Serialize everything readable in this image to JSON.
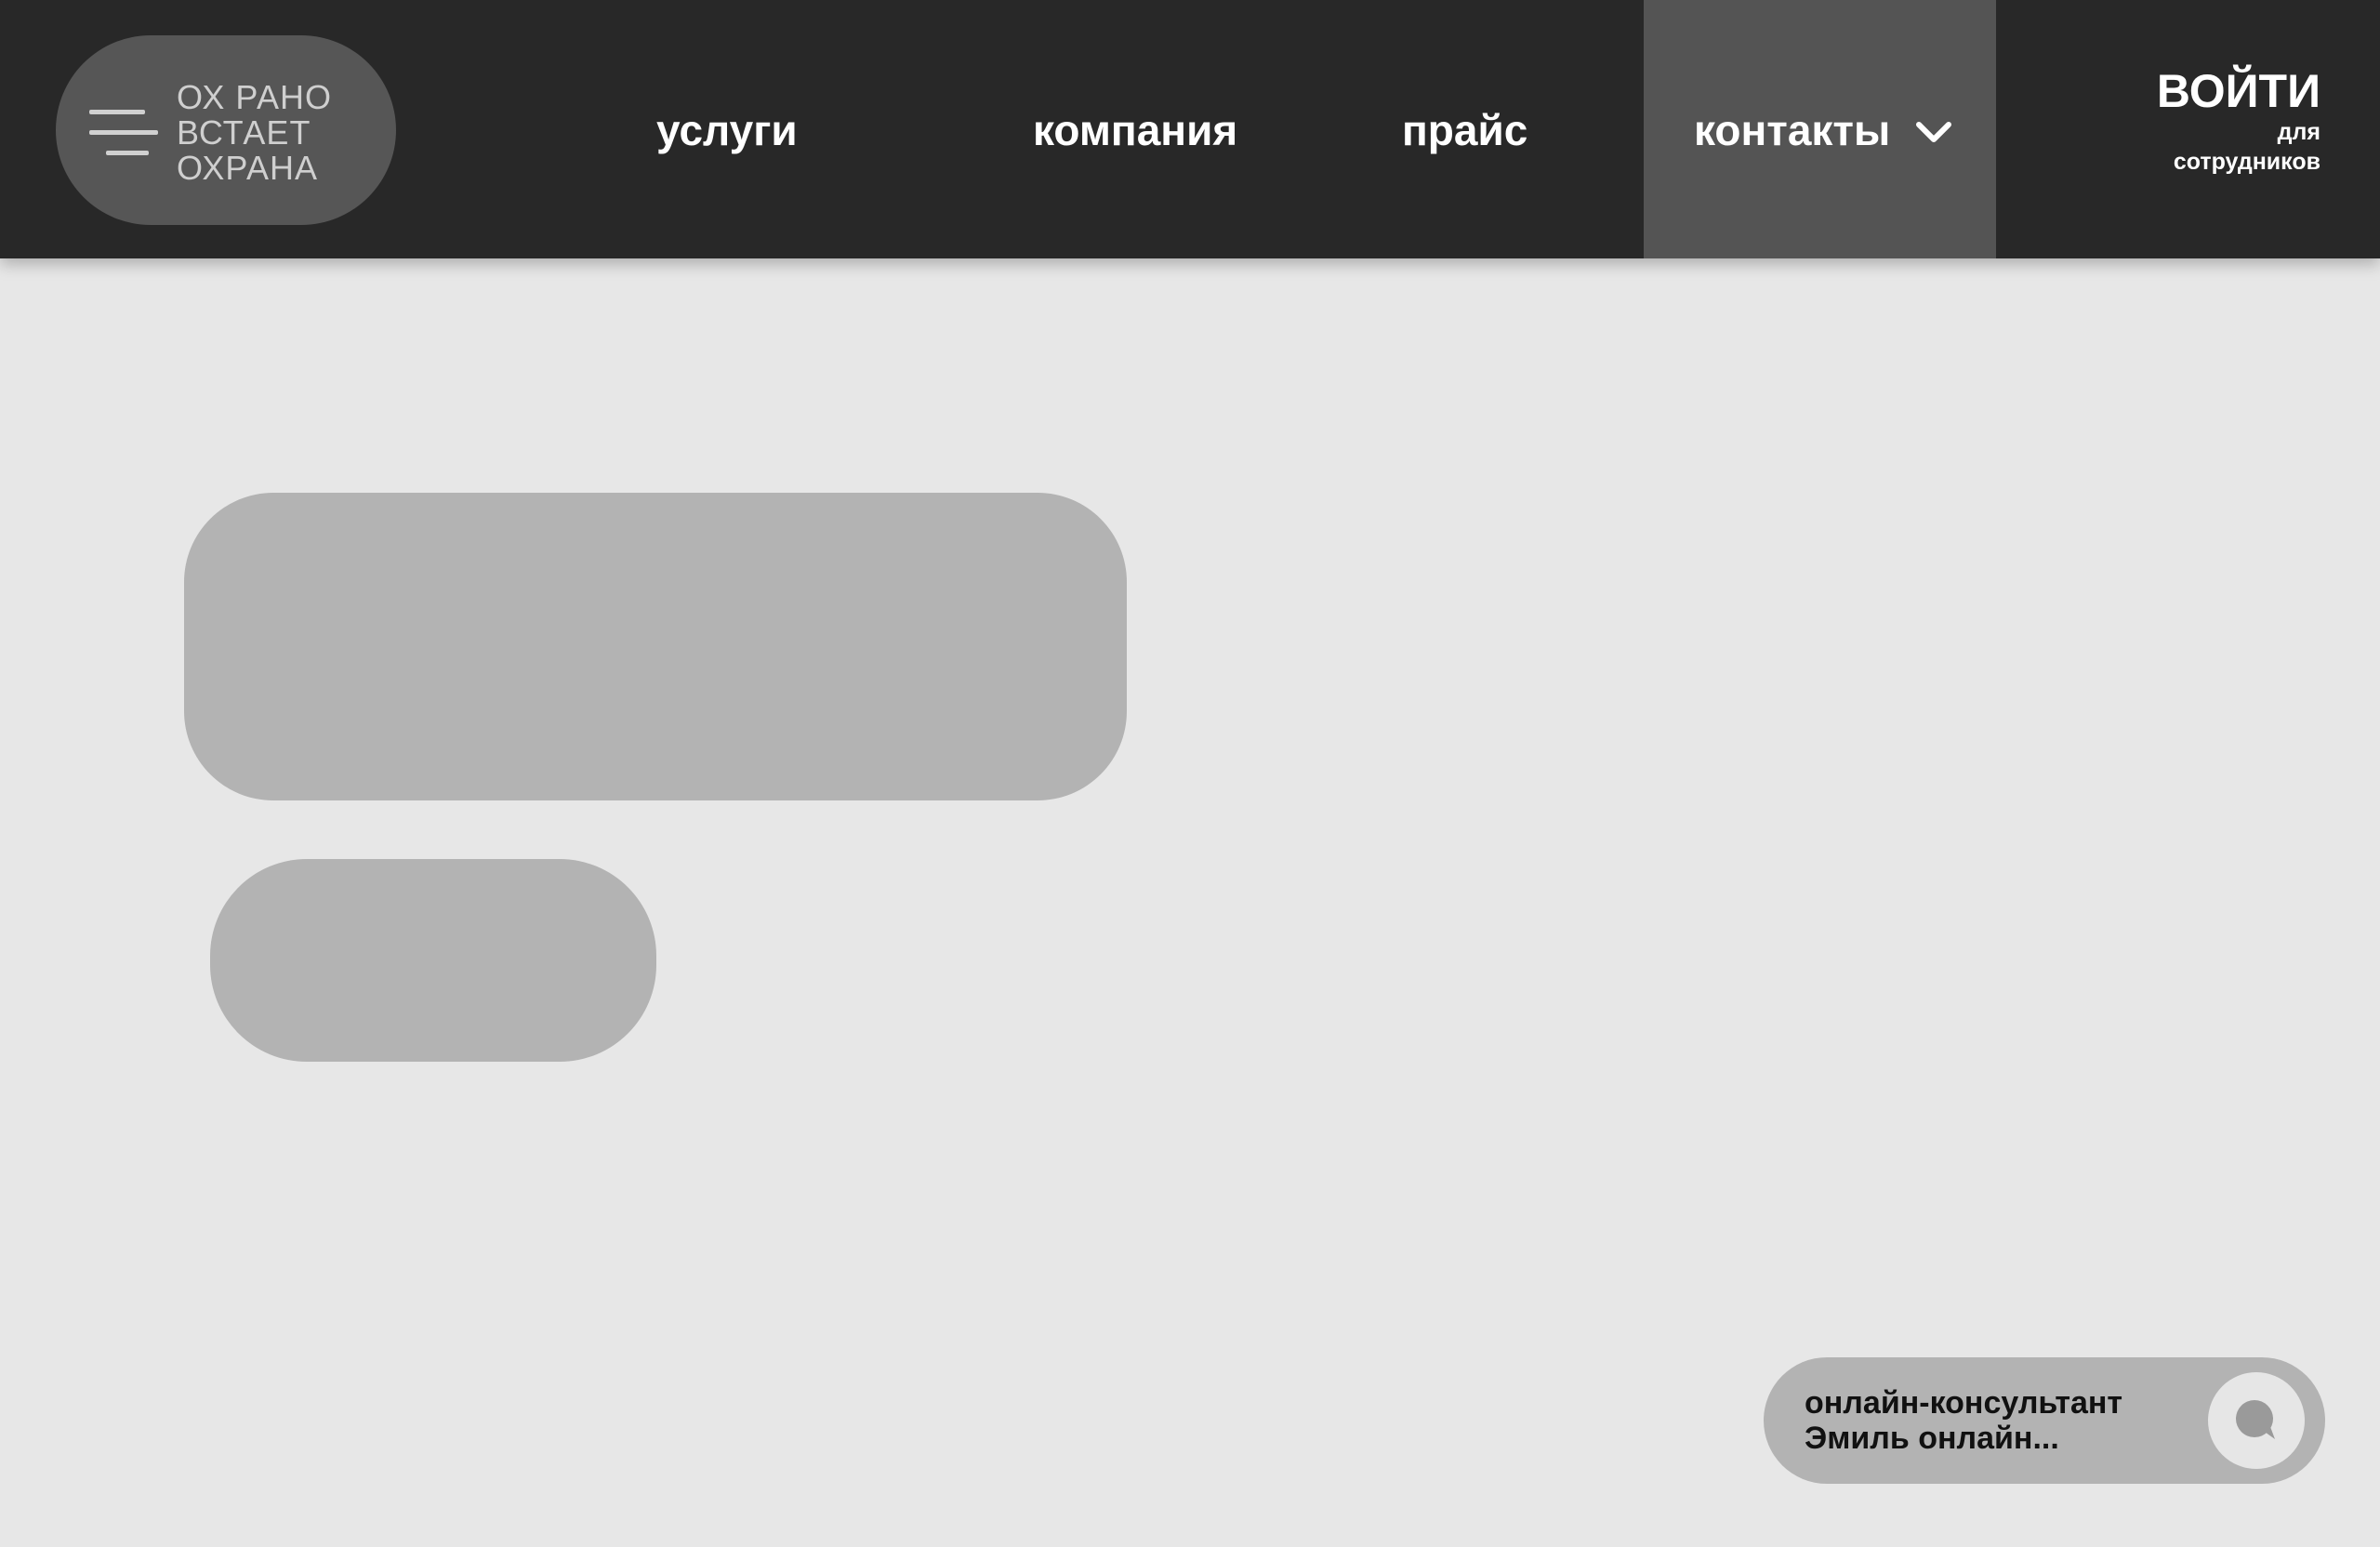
{
  "header": {
    "logo": {
      "lines": [
        "ОХ РАНО",
        "ВСТАЕТ",
        "ОХРАНА"
      ],
      "menu_icon": "hamburger-icon"
    },
    "nav": [
      {
        "label": "услуги"
      },
      {
        "label": "компания"
      },
      {
        "label": "прайс"
      },
      {
        "label": "контакты",
        "icon": "chevron-down-icon",
        "active": true
      }
    ],
    "login": {
      "title": "ВОЙТИ",
      "subtitle_line1": "для",
      "subtitle_line2": "сотрудников"
    }
  },
  "consultant": {
    "line1": "онлайн-консультант",
    "line2": "Эмиль онлайн...",
    "icon": "chat-bubble-icon"
  },
  "colors": {
    "header_bg": "#282828",
    "active_nav_bg": "#545454",
    "page_bg": "#e7e7e7",
    "placeholder": "#b3b3b3",
    "logo_pill": "#565656"
  }
}
